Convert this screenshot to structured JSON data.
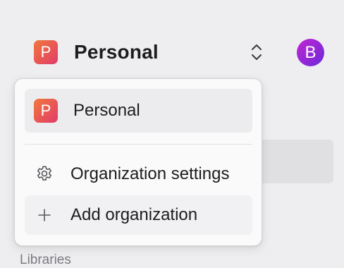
{
  "header": {
    "org_badge_letter": "P",
    "org_name": "Personal",
    "avatar_letter": "B"
  },
  "dropdown": {
    "current_org": {
      "badge_letter": "P",
      "name": "Personal"
    },
    "settings_label": "Organization settings",
    "add_label": "Add organization"
  },
  "sidebar": {
    "section_label": "Libraries"
  },
  "colors": {
    "badge_gradient": [
      "#f0783c",
      "#e23b6a"
    ],
    "avatar_gradient": [
      "#c026d3",
      "#6d28d9"
    ]
  },
  "icons": {
    "switcher": "chevron-up-down-icon",
    "settings": "gear-icon",
    "add": "plus-icon"
  }
}
